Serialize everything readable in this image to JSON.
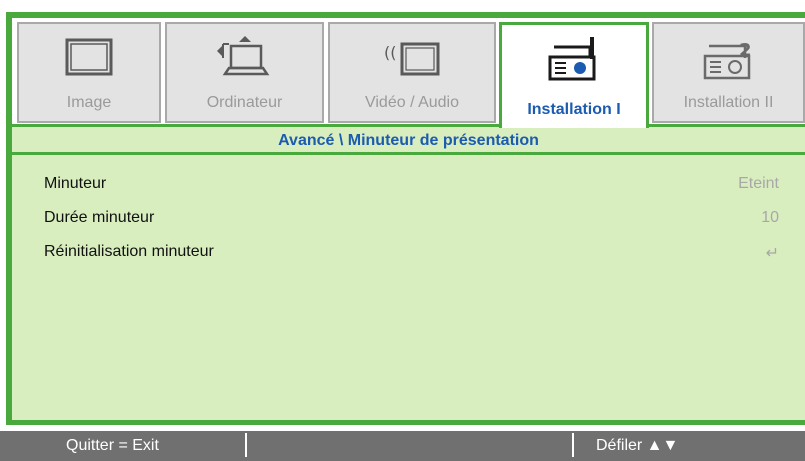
{
  "tabs": [
    {
      "label": "Image",
      "icon": "monitor-icon",
      "active": false
    },
    {
      "label": "Ordinateur",
      "icon": "laptop-icon",
      "active": false
    },
    {
      "label": "Vidéo / Audio",
      "icon": "video-audio-icon",
      "active": false
    },
    {
      "label": "Installation I",
      "icon": "projector-icon",
      "active": true
    },
    {
      "label": "Installation II",
      "icon": "projector-2-icon",
      "active": false
    }
  ],
  "breadcrumb": "Avancé \\ Minuteur de présentation",
  "settings": [
    {
      "label": "Minuteur",
      "value": "Eteint"
    },
    {
      "label": "Durée minuteur",
      "value": "10"
    },
    {
      "label": "Réinitialisation minuteur",
      "value": "↵",
      "value_icon": "enter-icon"
    }
  ],
  "footer": {
    "left": "Quitter = Exit",
    "right": "Défiler ▲▼"
  },
  "colors": {
    "accent_green": "#4aa93c",
    "panel_bg": "#d9eebf",
    "active_text": "#1b5bb0",
    "footer_bg": "#707070"
  }
}
